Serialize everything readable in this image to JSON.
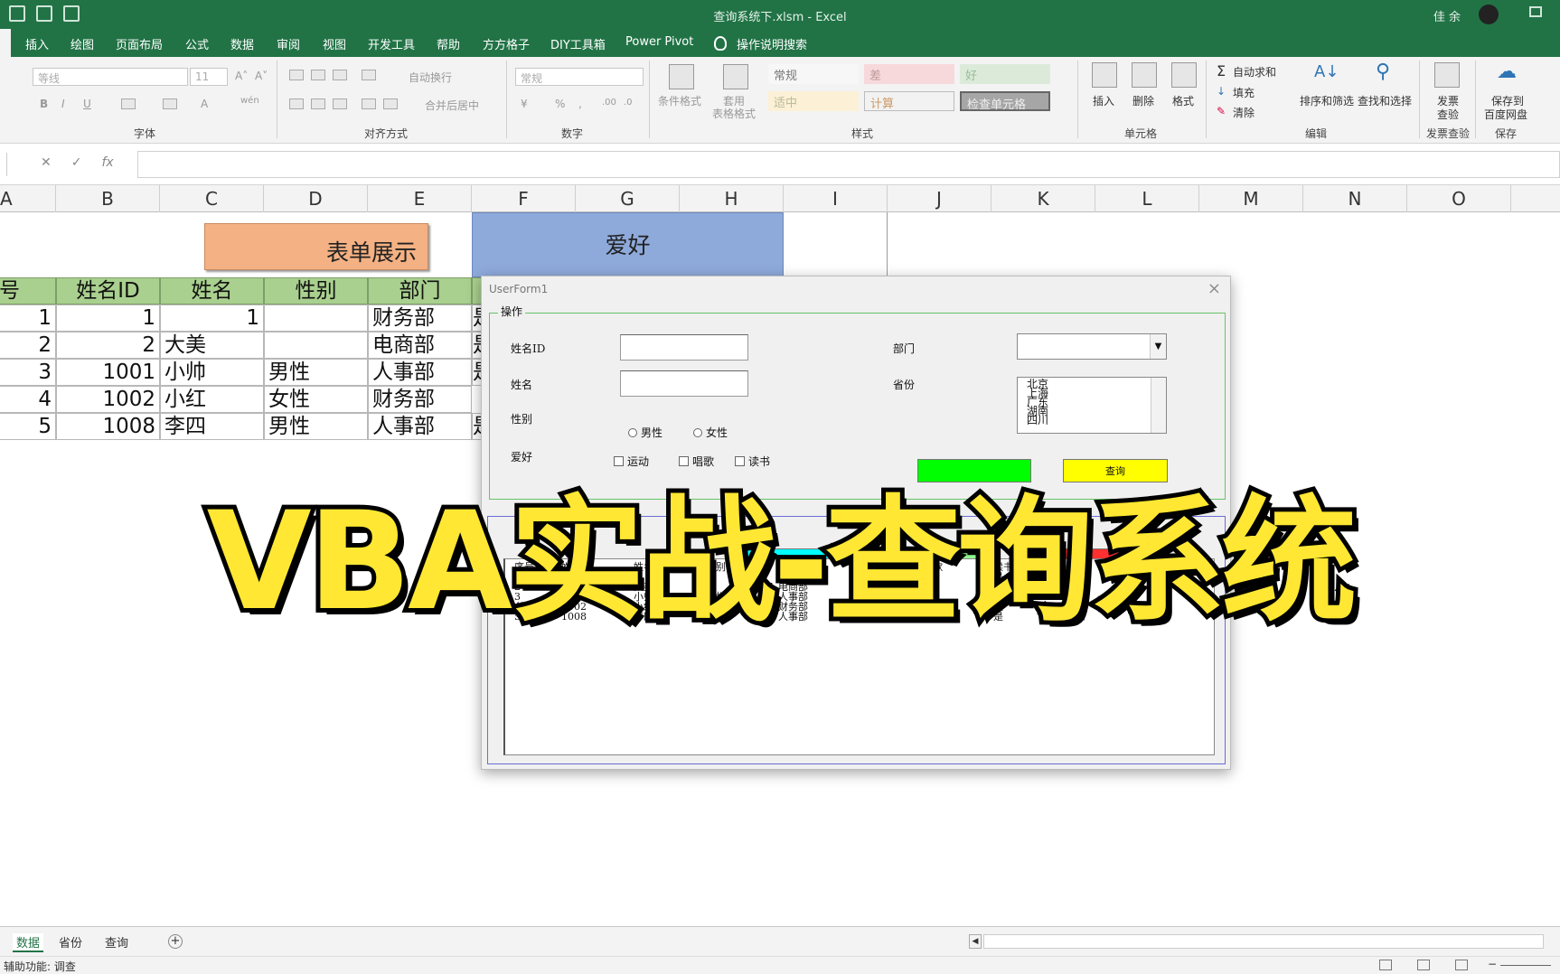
{
  "window": {
    "title": "查询系统下.xlsm  -  Excel",
    "user": "佳 余"
  },
  "menu": [
    "插入",
    "绘图",
    "页面布局",
    "公式",
    "数据",
    "审阅",
    "视图",
    "开发工具",
    "帮助",
    "方方格子",
    "DIY工具箱",
    "Power Pivot",
    "操作说明搜索"
  ],
  "ribbon": {
    "font_name": "等线",
    "font_size": "11",
    "number_format": "常规",
    "wrap": "自动换行",
    "merge": "合并后居中",
    "cond_format": "条件格式",
    "table_format": [
      "套用",
      "表格格式"
    ],
    "styles": [
      "常规",
      "差",
      "好",
      "适中",
      "计算",
      "检查单元格"
    ],
    "insert": "插入",
    "delete": "删除",
    "format": "格式",
    "autosum": "自动求和",
    "fill": "填充",
    "clear": "清除",
    "sort": "排序和筛选",
    "find": "查找和选择",
    "invoice": [
      "发票",
      "查验"
    ],
    "baidu": [
      "保存到",
      "百度网盘"
    ],
    "groups": {
      "font": "字体",
      "align": "对齐方式",
      "number": "数字",
      "styles": "样式",
      "cells": "单元格",
      "edit": "编辑",
      "invoice": "发票查验",
      "save": "保存"
    }
  },
  "columns": [
    "A",
    "B",
    "C",
    "D",
    "E",
    "F",
    "G",
    "H",
    "I",
    "J",
    "K",
    "L",
    "M",
    "N",
    "O"
  ],
  "sheet": {
    "button_show": "表单展示",
    "hobby_box": "爱好",
    "headers": [
      "号",
      "姓名ID",
      "姓名",
      "性别",
      "部门"
    ],
    "rows": [
      [
        "1",
        "1",
        "1",
        "",
        "财务部"
      ],
      [
        "2",
        "2",
        "大美",
        "",
        "电商部"
      ],
      [
        "3",
        "1001",
        "小帅",
        "男性",
        "人事部"
      ],
      [
        "4",
        "1002",
        "小红",
        "女性",
        "财务部"
      ],
      [
        "5",
        "1008",
        "李四",
        "男性",
        "人事部"
      ]
    ],
    "clipped_marker": "是"
  },
  "userform": {
    "title": "UserForm1",
    "close": "×",
    "frame_label": "操作",
    "label_id": "姓名ID",
    "label_name": "姓名",
    "label_gender": "性别",
    "label_hobby": "爱好",
    "label_dept": "部门",
    "label_province": "省份",
    "radio_male": "男性",
    "radio_female": "女性",
    "chk_sport": "运动",
    "chk_sing": "唱歌",
    "chk_read": "读书",
    "provinces": [
      "北京",
      "上海",
      "广东",
      "湖南",
      "四川"
    ],
    "query_button": "查询",
    "yellow_button": "查询",
    "list_headers": [
      "序号",
      "姓名ID",
      "姓名",
      "性别",
      "部门",
      "运动",
      "唱歌",
      "读书",
      "省份"
    ],
    "list_rows": [
      [
        "1",
        "1",
        "1",
        "",
        "财务部",
        "是",
        "是",
        "是",
        "湖南"
      ],
      [
        "2",
        "2",
        "大美",
        "",
        "电商部",
        "是",
        "是",
        "",
        "广东"
      ],
      [
        "3",
        "1001",
        "小帅",
        "男性",
        "人事部",
        "是",
        "是",
        "",
        "浙江"
      ],
      [
        "4",
        "1002",
        "小红",
        "女性",
        "财务部",
        "",
        "",
        "是",
        "甘肃"
      ],
      [
        "5",
        "1008",
        "李四",
        "男性",
        "人事部",
        "是",
        "是",
        "是",
        "广东"
      ]
    ]
  },
  "tabs": [
    "数据",
    "省份",
    "查询"
  ],
  "status": "辅助功能: 调查",
  "overlay_title": "VBA实战-查询系统",
  "colors": {
    "excel_green": "#217346",
    "header_green": "#a9d08e",
    "button_orange": "#f4b183",
    "hobby_blue": "#8eaadb",
    "overlay_yellow": "#ffe733"
  }
}
